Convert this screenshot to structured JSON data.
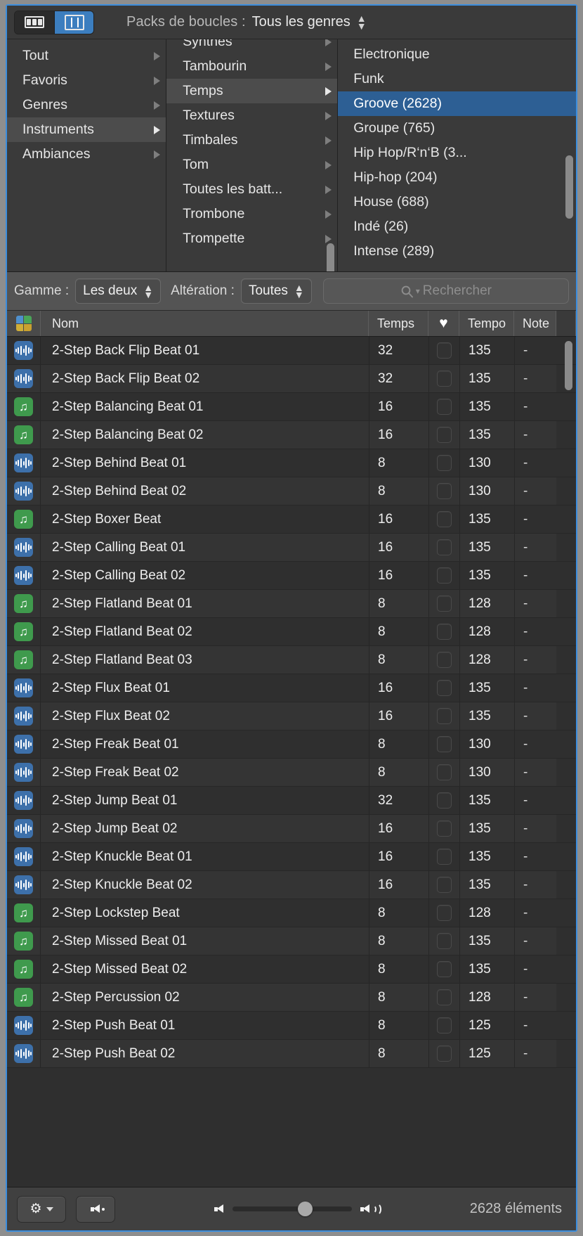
{
  "toolbar": {
    "view_list_label": "list-view",
    "view_column_label": "column-view",
    "loop_packs_label": "Packs de boucles :",
    "loop_packs_value": "Tous les genres"
  },
  "browser": {
    "column1": [
      {
        "label": "Tout",
        "has_arrow": true,
        "state": "normal"
      },
      {
        "label": "Favoris",
        "has_arrow": true,
        "state": "normal"
      },
      {
        "label": "Genres",
        "has_arrow": true,
        "state": "normal"
      },
      {
        "label": "Instruments",
        "has_arrow": true,
        "state": "highlight"
      },
      {
        "label": "Ambiances",
        "has_arrow": true,
        "state": "normal"
      }
    ],
    "column2": [
      {
        "label": "Synthés",
        "has_arrow": true,
        "state": "normal"
      },
      {
        "label": "Tambourin",
        "has_arrow": true,
        "state": "normal"
      },
      {
        "label": "Temps",
        "has_arrow": true,
        "state": "highlight"
      },
      {
        "label": "Textures",
        "has_arrow": true,
        "state": "normal"
      },
      {
        "label": "Timbales",
        "has_arrow": true,
        "state": "normal"
      },
      {
        "label": "Tom",
        "has_arrow": true,
        "state": "normal"
      },
      {
        "label": "Toutes les batt...",
        "has_arrow": true,
        "state": "normal"
      },
      {
        "label": "Trombone",
        "has_arrow": true,
        "state": "normal"
      },
      {
        "label": "Trompette",
        "has_arrow": true,
        "state": "normal"
      }
    ],
    "column3": [
      {
        "label": "Electronique",
        "state": "normal"
      },
      {
        "label": "Funk",
        "state": "normal"
      },
      {
        "label": "Groove (2628)",
        "state": "selected"
      },
      {
        "label": "Groupe (765)",
        "state": "normal"
      },
      {
        "label": "Hip Hop/R‘n‘B (3...",
        "state": "normal"
      },
      {
        "label": "Hip-hop (204)",
        "state": "normal"
      },
      {
        "label": "House (688)",
        "state": "normal"
      },
      {
        "label": "Indé (26)",
        "state": "normal"
      },
      {
        "label": "Intense (289)",
        "state": "normal"
      }
    ]
  },
  "filters": {
    "gamme_label": "Gamme :",
    "gamme_value": "Les deux",
    "alteration_label": "Altération :",
    "alteration_value": "Toutes",
    "search_placeholder": "Rechercher"
  },
  "table": {
    "headers": {
      "name": "Nom",
      "temps": "Temps",
      "favorite": "♥",
      "tempo": "Tempo",
      "note": "Note"
    },
    "rows": [
      {
        "kind": "audio",
        "name": "2-Step Back Flip Beat 01",
        "temps": "32",
        "tempo": "135",
        "note": "-",
        "favorite": false
      },
      {
        "kind": "audio",
        "name": "2-Step Back Flip Beat 02",
        "temps": "32",
        "tempo": "135",
        "note": "-",
        "favorite": false
      },
      {
        "kind": "midi",
        "name": "2-Step Balancing Beat 01",
        "temps": "16",
        "tempo": "135",
        "note": "-",
        "favorite": false
      },
      {
        "kind": "midi",
        "name": "2-Step Balancing Beat 02",
        "temps": "16",
        "tempo": "135",
        "note": "-",
        "favorite": false
      },
      {
        "kind": "audio",
        "name": "2-Step Behind Beat 01",
        "temps": "8",
        "tempo": "130",
        "note": "-",
        "favorite": false
      },
      {
        "kind": "audio",
        "name": "2-Step Behind Beat 02",
        "temps": "8",
        "tempo": "130",
        "note": "-",
        "favorite": false
      },
      {
        "kind": "midi",
        "name": "2-Step Boxer Beat",
        "temps": "16",
        "tempo": "135",
        "note": "-",
        "favorite": false
      },
      {
        "kind": "audio",
        "name": "2-Step Calling Beat 01",
        "temps": "16",
        "tempo": "135",
        "note": "-",
        "favorite": false
      },
      {
        "kind": "audio",
        "name": "2-Step Calling Beat 02",
        "temps": "16",
        "tempo": "135",
        "note": "-",
        "favorite": false
      },
      {
        "kind": "midi",
        "name": "2-Step Flatland Beat 01",
        "temps": "8",
        "tempo": "128",
        "note": "-",
        "favorite": false
      },
      {
        "kind": "midi",
        "name": "2-Step Flatland Beat 02",
        "temps": "8",
        "tempo": "128",
        "note": "-",
        "favorite": false
      },
      {
        "kind": "midi",
        "name": "2-Step Flatland Beat 03",
        "temps": "8",
        "tempo": "128",
        "note": "-",
        "favorite": false
      },
      {
        "kind": "audio",
        "name": "2-Step Flux Beat 01",
        "temps": "16",
        "tempo": "135",
        "note": "-",
        "favorite": false
      },
      {
        "kind": "audio",
        "name": "2-Step Flux Beat 02",
        "temps": "16",
        "tempo": "135",
        "note": "-",
        "favorite": false
      },
      {
        "kind": "audio",
        "name": "2-Step Freak Beat 01",
        "temps": "8",
        "tempo": "130",
        "note": "-",
        "favorite": false
      },
      {
        "kind": "audio",
        "name": "2-Step Freak Beat 02",
        "temps": "8",
        "tempo": "130",
        "note": "-",
        "favorite": false
      },
      {
        "kind": "audio",
        "name": "2-Step Jump Beat 01",
        "temps": "32",
        "tempo": "135",
        "note": "-",
        "favorite": false
      },
      {
        "kind": "audio",
        "name": "2-Step Jump Beat 02",
        "temps": "16",
        "tempo": "135",
        "note": "-",
        "favorite": false
      },
      {
        "kind": "audio",
        "name": "2-Step Knuckle Beat 01",
        "temps": "16",
        "tempo": "135",
        "note": "-",
        "favorite": false
      },
      {
        "kind": "audio",
        "name": "2-Step Knuckle Beat 02",
        "temps": "16",
        "tempo": "135",
        "note": "-",
        "favorite": false
      },
      {
        "kind": "midi",
        "name": "2-Step Lockstep Beat",
        "temps": "8",
        "tempo": "128",
        "note": "-",
        "favorite": false
      },
      {
        "kind": "midi",
        "name": "2-Step Missed Beat 01",
        "temps": "8",
        "tempo": "135",
        "note": "-",
        "favorite": false
      },
      {
        "kind": "midi",
        "name": "2-Step Missed Beat 02",
        "temps": "8",
        "tempo": "135",
        "note": "-",
        "favorite": false
      },
      {
        "kind": "midi",
        "name": "2-Step Percussion 02",
        "temps": "8",
        "tempo": "128",
        "note": "-",
        "favorite": false
      },
      {
        "kind": "audio",
        "name": "2-Step Push Beat 01",
        "temps": "8",
        "tempo": "125",
        "note": "-",
        "favorite": false
      },
      {
        "kind": "audio",
        "name": "2-Step Push Beat 02",
        "temps": "8",
        "tempo": "125",
        "note": "-",
        "favorite": false
      }
    ]
  },
  "bottom": {
    "settings_label": "gear-menu",
    "mute_label": "mute-toggle",
    "volume_percent": 55,
    "item_count": "2628 éléments"
  },
  "colors": {
    "accent": "#3c7ebf",
    "selection": "#2d5f94",
    "audio_icon": "#3d70aa",
    "midi_icon": "#3f9a4d",
    "window_border": "#3b8ddd"
  }
}
